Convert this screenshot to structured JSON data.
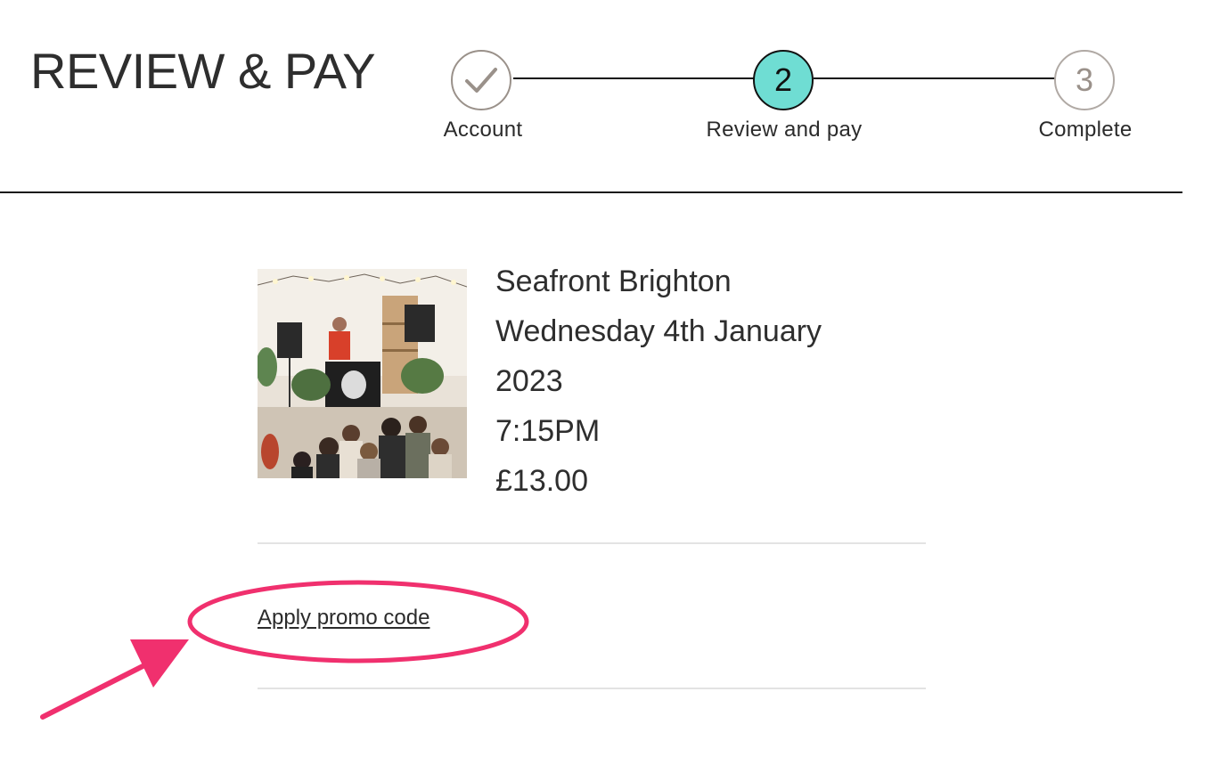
{
  "header": {
    "title": "REVIEW & PAY"
  },
  "stepper": {
    "steps": [
      {
        "label": "Account",
        "number": "",
        "state": "done"
      },
      {
        "label": "Review and pay",
        "number": "2",
        "state": "active"
      },
      {
        "label": "Complete",
        "number": "3",
        "state": "todo"
      }
    ],
    "active_color": "#6fddd3"
  },
  "event": {
    "venue": "Seafront Brighton",
    "date_line1": "Wednesday 4th January",
    "date_line2": "2023",
    "time": "7:15PM",
    "price": "£13.00",
    "image_icon": "event-photo"
  },
  "promo": {
    "link_label": "Apply promo code"
  },
  "annotation": {
    "highlight_color": "#f0306e"
  }
}
